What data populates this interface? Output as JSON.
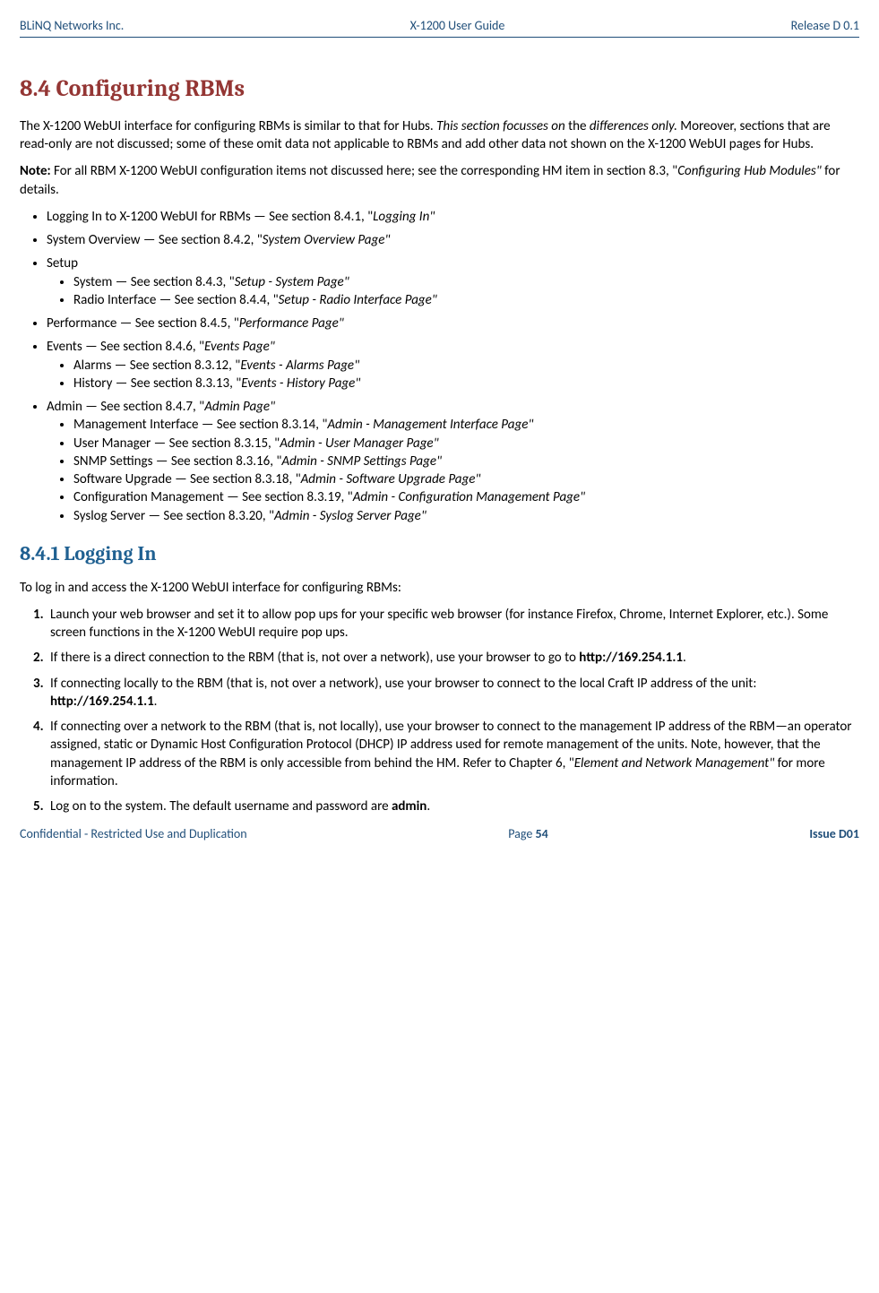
{
  "header": {
    "left": "BLiNQ Networks Inc.",
    "center": "X-1200 User Guide",
    "right": "Release D 0.1"
  },
  "footer": {
    "left": "Confidential - Restricted Use and Duplication",
    "center_prefix": "Page ",
    "center_num": "54",
    "right": "Issue D01"
  },
  "s84": {
    "heading": "8.4  Configuring RBMs",
    "p1_a": "The X-1200 WebUI interface for configuring RBMs is similar to that for Hubs. ",
    "p1_b": "This section focusses on ",
    "p1_c": "the ",
    "p1_d": "differences only.",
    "p1_e": " Moreover, sections that are read-only are not discussed; some of these omit data not applicable to RBMs and add other data not shown on the X-1200 WebUI pages for Hubs.",
    "p2_a": "Note:",
    "p2_b": " For all RBM X-1200 WebUI configuration items not discussed here; see the corresponding HM item in section 8.3, \"",
    "p2_c": "Configuring Hub Modules\"",
    "p2_d": " for details.",
    "b1_a": "Logging In to X-1200 WebUI for RBMs — See section 8.4.1, \"",
    "b1_b": "Logging In\"",
    "b2_a": "System Overview — See section 8.4.2, \"",
    "b2_b": "System Overview Page\"",
    "b3": "Setup",
    "b3_1_a": "System — See section 8.4.3, \"",
    "b3_1_b": "Setup - System Page\"",
    "b3_2_a": "Radio Interface — See section 8.4.4, \"",
    "b3_2_b": "Setup - Radio Interface Page\"",
    "b4_a": "Performance — See section 8.4.5, \"",
    "b4_b": "Performance Page\"",
    "b5_a": "Events — See section 8.4.6, \"",
    "b5_b": "Events Page\"",
    "b5_1_a": "Alarms — See section 8.3.12, \"",
    "b5_1_b": "Events - Alarms Page\"",
    "b5_2_a": "History — See section 8.3.13, \"",
    "b5_2_b": "Events - History Page\"",
    "b6_a": "Admin — See section 8.4.7, \"",
    "b6_b": "Admin Page\"",
    "b6_1_a": "Management Interface — See section 8.3.14, \"",
    "b6_1_b": "Admin - Management Interface Page\"",
    "b6_2_a": "User Manager — See section 8.3.15, \"",
    "b6_2_b": "Admin - User Manager Page\"",
    "b6_3_a": "SNMP Settings — See section 8.3.16, \"",
    "b6_3_b": "Admin - SNMP Settings Page\"",
    "b6_4_a": "Software Upgrade — See section 8.3.18, \"",
    "b6_4_b": "Admin - Software Upgrade Page\"",
    "b6_5_a": "Configuration Management — See section 8.3.19, \"",
    "b6_5_b": "Admin - Configuration Management Page\"",
    "b6_6_a": "Syslog Server — See section 8.3.20, \"",
    "b6_6_b": "Admin - Syslog Server Page\""
  },
  "s841": {
    "heading": "8.4.1 Logging In",
    "intro": "To log in and access the X-1200 WebUI interface for configuring RBMs:",
    "step1": "Launch your web browser and set it to allow pop ups for your specific web browser (for instance Firefox, Chrome, Internet Explorer, etc.). Some screen functions in the X-1200 WebUI require pop ups.",
    "step2_a": "If there is a direct connection to the RBM (that is, not over a network), use your browser to go to ",
    "step2_b": "http://169.254.1.1",
    "step2_c": ".",
    "step3_a": "If connecting locally to the RBM (that is, not over a network), use your browser to connect to the local Craft IP address of the unit: ",
    "step3_b": "http://169.254.1.1",
    "step3_c": ".",
    "step4_a": "If connecting over a network to the RBM (that is, not locally), use your browser to connect to the management IP address of the RBM—an operator assigned, static or Dynamic Host Configuration Protocol (DHCP) IP address used for remote management of the units. Note, however, that the management IP address of the RBM is only accessible from behind the HM. Refer to Chapter 6, \"",
    "step4_b": "Element and Network Management\"",
    "step4_c": " for more information.",
    "step5_a": "Log on to the system.  The default username and password are ",
    "step5_b": "admin",
    "step5_c": "."
  }
}
